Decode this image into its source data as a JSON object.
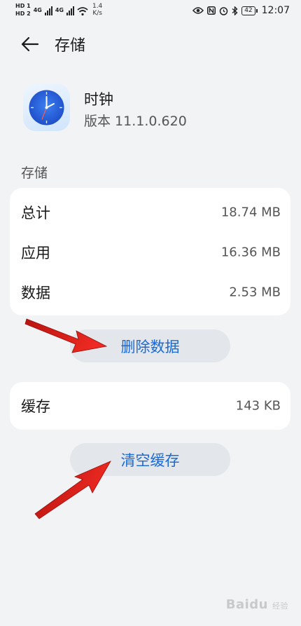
{
  "status_bar": {
    "sim1": "HD 1",
    "sim2": "HD 2",
    "network1": "4G",
    "network2": "4G",
    "speed_value": "1.4",
    "speed_unit": "K/s",
    "battery": "42",
    "time": "12:07"
  },
  "header": {
    "title": "存储"
  },
  "app": {
    "name": "时钟",
    "version": "版本 11.1.0.620"
  },
  "storage": {
    "section_label": "存储",
    "rows": [
      {
        "label": "总计",
        "value": "18.74 MB"
      },
      {
        "label": "应用",
        "value": "16.36 MB"
      },
      {
        "label": "数据",
        "value": "2.53 MB"
      }
    ],
    "delete_button": "删除数据"
  },
  "cache": {
    "label": "缓存",
    "value": "143 KB",
    "clear_button": "清空缓存"
  },
  "watermark": {
    "text": "Baidu",
    "subtext": "经验"
  },
  "colors": {
    "accent": "#1a6ad6",
    "background": "#f1f3f5",
    "card": "#ffffff",
    "arrow": "#e8211c"
  }
}
